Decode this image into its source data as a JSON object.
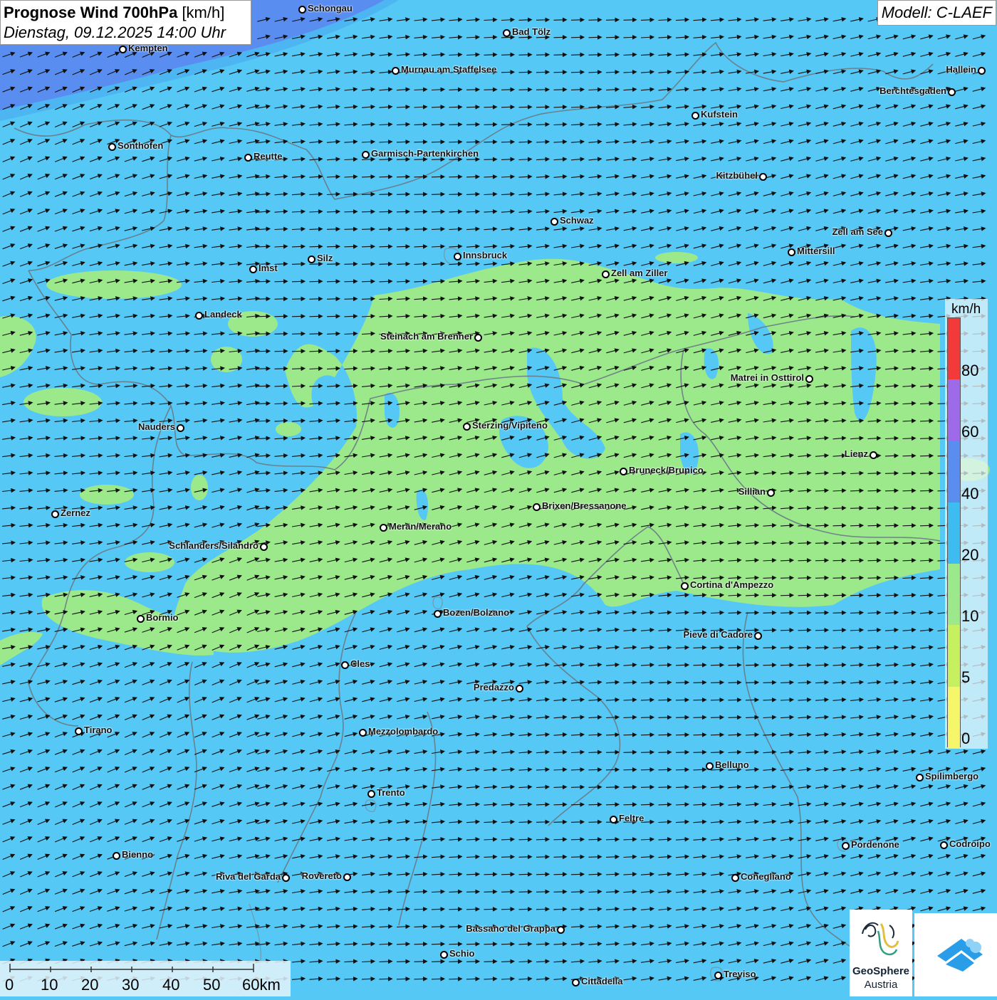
{
  "header": {
    "title_bold": "Prognose Wind 700hPa",
    "title_unit": "[km/h]",
    "datetime": "Dienstag, 09.12.2025 14:00 Uhr",
    "model": "Modell: C-LAEF"
  },
  "colors": {
    "background": "#55c8f5",
    "zone_light": "#9ce98b",
    "zone_blue": "#3fb7ee",
    "border_line": "#6a7a86",
    "arrow": "#111111"
  },
  "legend": {
    "unit": "km/h",
    "labels": [
      "80",
      "60",
      "40",
      "20",
      "10",
      "5",
      "0"
    ],
    "segments": [
      {
        "color": "#f33a3a"
      },
      {
        "color": "#9d6bea"
      },
      {
        "color": "#5a8df0"
      },
      {
        "color": "#3dbcf2"
      },
      {
        "color": "#9ce98b"
      },
      {
        "color": "#c6f060"
      },
      {
        "color": "#f6f66a"
      }
    ]
  },
  "scalebar": {
    "labels": [
      "0",
      "10",
      "20",
      "30",
      "40",
      "50",
      "60km"
    ]
  },
  "logos": {
    "geosphere_line1": "GeoSphere",
    "geosphere_line2": "Austria",
    "app_icon": "cloud-chevron-icon"
  },
  "cities": [
    {
      "name": "Schongau",
      "label_side": "right"
    },
    {
      "name": "Bad Tölz",
      "label_side": "right"
    },
    {
      "name": "Kempten",
      "label_side": "right"
    },
    {
      "name": "Murnau am Staffelsee",
      "label_side": "right"
    },
    {
      "name": "Hallein",
      "label_side": "left"
    },
    {
      "name": "Berchtesgaden",
      "label_side": "left"
    },
    {
      "name": "Kufstein",
      "label_side": "right"
    },
    {
      "name": "Sonthofen",
      "label_side": "right"
    },
    {
      "name": "Reutte",
      "label_side": "right"
    },
    {
      "name": "Garmisch-Partenkirchen",
      "label_side": "right"
    },
    {
      "name": "Kitzbühel",
      "label_side": "left"
    },
    {
      "name": "Schwaz",
      "label_side": "right"
    },
    {
      "name": "Zell am See",
      "label_side": "left"
    },
    {
      "name": "Mittersill",
      "label_side": "right"
    },
    {
      "name": "Innsbruck",
      "label_side": "right"
    },
    {
      "name": "Silz",
      "label_side": "right"
    },
    {
      "name": "Imst",
      "label_side": "right"
    },
    {
      "name": "Zell am Ziller",
      "label_side": "right"
    },
    {
      "name": "Landeck",
      "label_side": "right"
    },
    {
      "name": "Steinach am Brenner",
      "label_side": "left"
    },
    {
      "name": "Matrei in Osttirol",
      "label_side": "left"
    },
    {
      "name": "Nauders",
      "label_side": "left"
    },
    {
      "name": "Sterzing/Vipiteno",
      "label_side": "right"
    },
    {
      "name": "Lienz",
      "label_side": "left"
    },
    {
      "name": "Bruneck/Brunico",
      "label_side": "right"
    },
    {
      "name": "Sillian",
      "label_side": "left"
    },
    {
      "name": "Zernez",
      "label_side": "right"
    },
    {
      "name": "Brixen/Bressanone",
      "label_side": "right"
    },
    {
      "name": "Meran/Merano",
      "label_side": "right"
    },
    {
      "name": "Schlanders/Silandro",
      "label_side": "left"
    },
    {
      "name": "Cortina d'Ampezzo",
      "label_side": "right"
    },
    {
      "name": "Bozen/Bolzano",
      "label_side": "right"
    },
    {
      "name": "Bormio",
      "label_side": "right"
    },
    {
      "name": "Pieve di Cadore",
      "label_side": "left"
    },
    {
      "name": "Cles",
      "label_side": "right"
    },
    {
      "name": "Predazzo",
      "label_side": "left"
    },
    {
      "name": "Tirano",
      "label_side": "right"
    },
    {
      "name": "Mezzolombardo",
      "label_side": "right"
    },
    {
      "name": "Belluno",
      "label_side": "right"
    },
    {
      "name": "Spilimbergo",
      "label_side": "right"
    },
    {
      "name": "Trento",
      "label_side": "right"
    },
    {
      "name": "Feltre",
      "label_side": "right"
    },
    {
      "name": "Pordenone",
      "label_side": "right"
    },
    {
      "name": "Codroipo",
      "label_side": "right"
    },
    {
      "name": "Bienno",
      "label_side": "right"
    },
    {
      "name": "Riva del Garda",
      "label_side": "left"
    },
    {
      "name": "Rovereto",
      "label_side": "left"
    },
    {
      "name": "Conegliano",
      "label_side": "right"
    },
    {
      "name": "Bassano del Grappa",
      "label_side": "left"
    },
    {
      "name": "Schio",
      "label_side": "right"
    },
    {
      "name": "Treviso",
      "label_side": "right"
    },
    {
      "name": "Cittadella",
      "label_side": "right"
    }
  ]
}
